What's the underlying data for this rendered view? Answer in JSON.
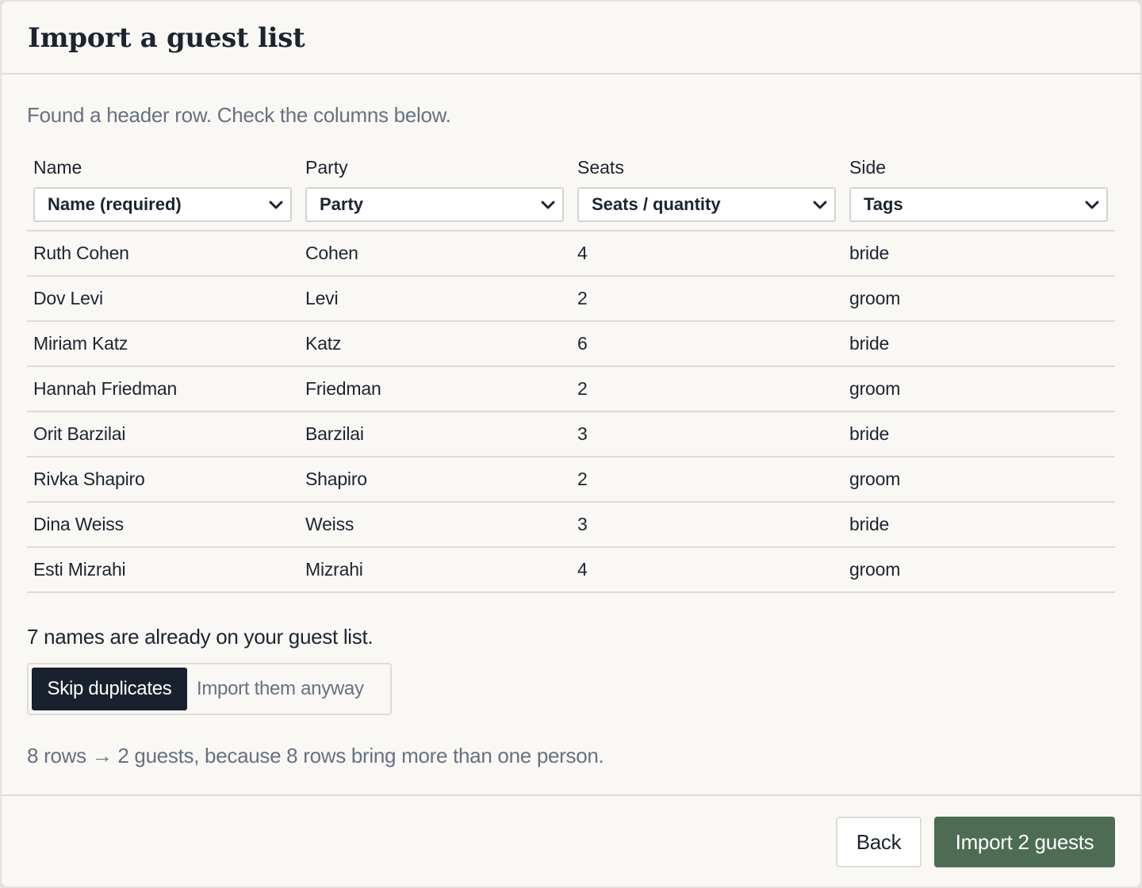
{
  "dialog": {
    "title": "Import a guest list",
    "intro": "Found a header row. Check the columns below."
  },
  "columns": [
    {
      "header": "Name",
      "mapping": "Name (required)"
    },
    {
      "header": "Party",
      "mapping": "Party"
    },
    {
      "header": "Seats",
      "mapping": "Seats / quantity"
    },
    {
      "header": "Side",
      "mapping": "Tags"
    }
  ],
  "rows": [
    [
      "Ruth Cohen",
      "Cohen",
      "4",
      "bride"
    ],
    [
      "Dov Levi",
      "Levi",
      "2",
      "groom"
    ],
    [
      "Miriam Katz",
      "Katz",
      "6",
      "bride"
    ],
    [
      "Hannah Friedman",
      "Friedman",
      "2",
      "groom"
    ],
    [
      "Orit Barzilai",
      "Barzilai",
      "3",
      "bride"
    ],
    [
      "Rivka Shapiro",
      "Shapiro",
      "2",
      "groom"
    ],
    [
      "Dina Weiss",
      "Weiss",
      "3",
      "bride"
    ],
    [
      "Esti Mizrahi",
      "Mizrahi",
      "4",
      "groom"
    ]
  ],
  "duplicates": {
    "note": "7 names are already on your guest list.",
    "options": [
      "Skip duplicates",
      "Import them anyway"
    ],
    "selected": "Skip duplicates"
  },
  "summary": "8 rows → 2 guests, because 8 rows bring more than one person.",
  "footer": {
    "back_label": "Back",
    "import_label": "Import 2 guests"
  },
  "icons": {
    "select_arrow": "chevron-down-icon"
  },
  "colors": {
    "primary_button": "#4e6b54",
    "selected_segment": "#18212d",
    "background": "#f9f8f5"
  }
}
